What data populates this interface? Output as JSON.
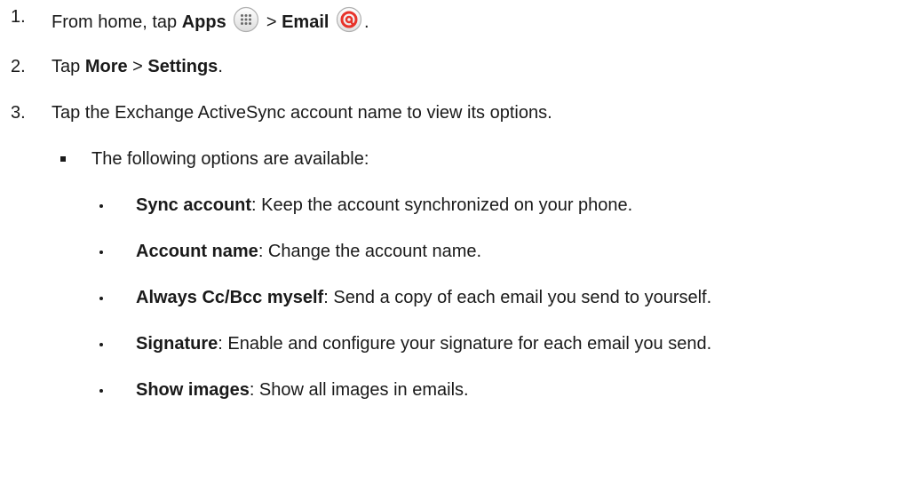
{
  "steps": [
    {
      "number": "1.",
      "text_before_apps": "From home, tap ",
      "apps_label": "Apps",
      "separator": " > ",
      "email_label": "Email",
      "end_punct": ".",
      "apps_icon": "apps-grid-icon",
      "email_icon": "email-app-icon"
    },
    {
      "number": "2.",
      "text_before": "Tap ",
      "more_label": "More",
      "separator": " > ",
      "settings_label": "Settings",
      "end_punct": "."
    },
    {
      "number": "3.",
      "text": "Tap the Exchange ActiveSync account name to view its options."
    }
  ],
  "sub_intro": "The following options are available:",
  "options": [
    {
      "term": "Sync account",
      "desc": ": Keep the account synchronized on your phone."
    },
    {
      "term": "Account name",
      "desc": ": Change the account name."
    },
    {
      "term": "Always Cc/Bcc myself",
      "desc": ": Send a copy of each email you send to yourself."
    },
    {
      "term": "Signature",
      "desc": ": Enable and configure your signature for each email you send."
    },
    {
      "term": "Show images",
      "desc": ": Show all images in emails."
    }
  ],
  "colors": {
    "text": "#1a1a1a",
    "email_icon_red": "#e8332a",
    "icon_border": "#b0b0b0"
  }
}
